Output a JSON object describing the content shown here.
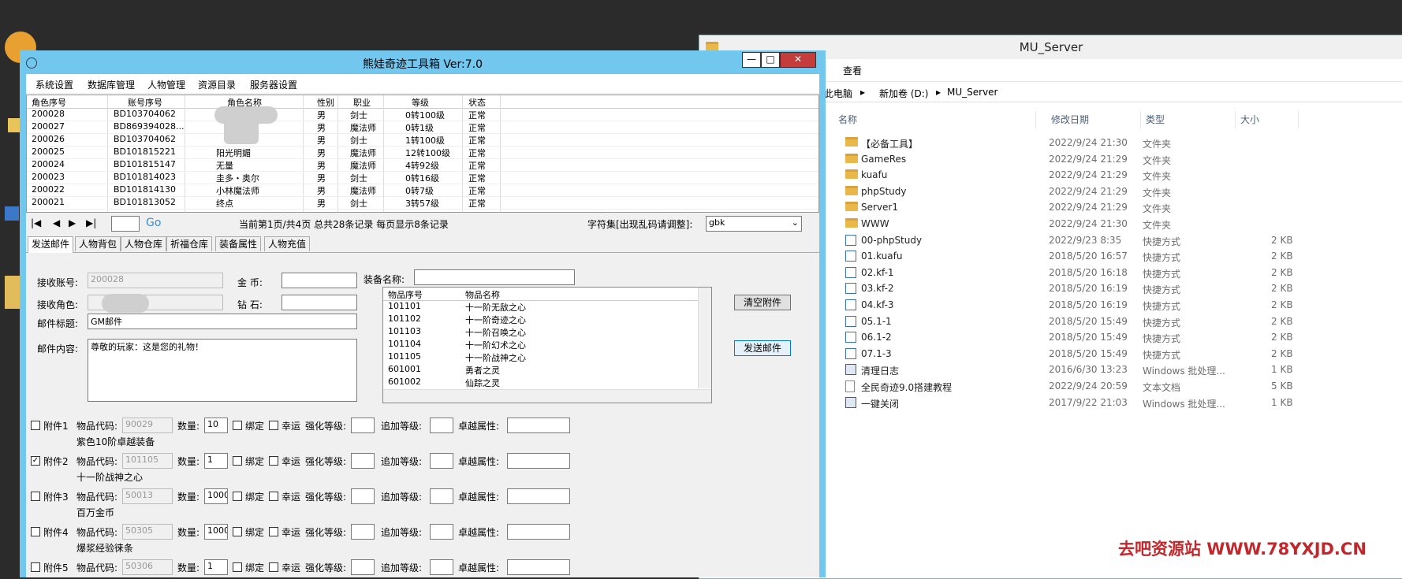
{
  "explorer": {
    "title": "MU_Server",
    "ribbon_view": "查看",
    "breadcrumb": [
      "此电脑",
      "新加卷 (D:)",
      "MU_Server"
    ],
    "columns": [
      "名称",
      "修改日期",
      "类型",
      "大小"
    ],
    "files": [
      {
        "name": "【必备工具】",
        "date": "2022/9/24 21:30",
        "type": "文件夹",
        "size": "",
        "icon": "folder-icon"
      },
      {
        "name": "GameRes",
        "date": "2022/9/24 21:29",
        "type": "文件夹",
        "size": "",
        "icon": "folder-icon"
      },
      {
        "name": "kuafu",
        "date": "2022/9/24 21:29",
        "type": "文件夹",
        "size": "",
        "icon": "folder-icon"
      },
      {
        "name": "phpStudy",
        "date": "2022/9/24 21:29",
        "type": "文件夹",
        "size": "",
        "icon": "folder-icon"
      },
      {
        "name": "Server1",
        "date": "2022/9/24 21:29",
        "type": "文件夹",
        "size": "",
        "icon": "folder-icon"
      },
      {
        "name": "WWW",
        "date": "2022/9/24 21:30",
        "type": "文件夹",
        "size": "",
        "icon": "folder-icon"
      },
      {
        "name": "00-phpStudy",
        "date": "2022/9/23 8:35",
        "type": "快捷方式",
        "size": "2 KB",
        "icon": "shortcut-icon"
      },
      {
        "name": "01.kuafu",
        "date": "2018/5/20 16:57",
        "type": "快捷方式",
        "size": "2 KB",
        "icon": "shortcut-icon"
      },
      {
        "name": "02.kf-1",
        "date": "2018/5/20 16:18",
        "type": "快捷方式",
        "size": "2 KB",
        "icon": "shortcut-icon"
      },
      {
        "name": "03.kf-2",
        "date": "2018/5/20 16:19",
        "type": "快捷方式",
        "size": "2 KB",
        "icon": "shortcut-icon"
      },
      {
        "name": "04.kf-3",
        "date": "2018/5/20 16:19",
        "type": "快捷方式",
        "size": "2 KB",
        "icon": "shortcut-icon"
      },
      {
        "name": "05.1-1",
        "date": "2018/5/20 15:49",
        "type": "快捷方式",
        "size": "2 KB",
        "icon": "shortcut-icon"
      },
      {
        "name": "06.1-2",
        "date": "2018/5/20 15:49",
        "type": "快捷方式",
        "size": "2 KB",
        "icon": "shortcut-icon"
      },
      {
        "name": "07.1-3",
        "date": "2018/5/20 15:49",
        "type": "快捷方式",
        "size": "2 KB",
        "icon": "shortcut-icon"
      },
      {
        "name": "清理日志",
        "date": "2016/6/30 13:23",
        "type": "Windows 批处理...",
        "size": "1 KB",
        "icon": "batch-file-icon"
      },
      {
        "name": "全民奇迹9.0搭建教程",
        "date": "2022/9/24 20:59",
        "type": "文本文档",
        "size": "5 KB",
        "icon": "text-file-icon"
      },
      {
        "name": "一键关闭",
        "date": "2017/9/22 21:03",
        "type": "Windows 批处理...",
        "size": "1 KB",
        "icon": "batch-file-icon"
      }
    ]
  },
  "watermark": "去吧资源站  WWW.78YXJD.CN",
  "app": {
    "title": "熊娃奇迹工具箱 Ver:7.0",
    "menu": [
      "系统设置",
      "数据库管理",
      "人物管理",
      "资源目录",
      "服务器设置"
    ],
    "grid_columns": [
      "角色序号",
      "账号序号",
      "角色名称",
      "性别",
      "职业",
      "等级",
      "状态"
    ],
    "grid_rows": [
      {
        "id": "200028",
        "acct": "BD103704062",
        "name": "",
        "sex": "男",
        "job": "剑士",
        "level": "0转100级",
        "status": "正常"
      },
      {
        "id": "200027",
        "acct": "BD869394028...",
        "name": "",
        "sex": "男",
        "job": "魔法师",
        "level": "0转1级",
        "status": "正常"
      },
      {
        "id": "200026",
        "acct": "BD103704062",
        "name": "",
        "sex": "男",
        "job": "剑士",
        "level": "1转100级",
        "status": "正常"
      },
      {
        "id": "200025",
        "acct": "BD101815221",
        "name": "阳光明媚",
        "sex": "男",
        "job": "魔法师",
        "level": "12转100级",
        "status": "正常"
      },
      {
        "id": "200024",
        "acct": "BD101815147",
        "name": "无量",
        "sex": "男",
        "job": "魔法师",
        "level": "4转92级",
        "status": "正常"
      },
      {
        "id": "200023",
        "acct": "BD101814023",
        "name": "圭多・奥尔",
        "sex": "男",
        "job": "剑士",
        "level": "0转16级",
        "status": "正常"
      },
      {
        "id": "200022",
        "acct": "BD101814130",
        "name": "小林魔法师",
        "sex": "男",
        "job": "魔法师",
        "level": "0转7级",
        "status": "正常"
      },
      {
        "id": "200021",
        "acct": "BD101813052",
        "name": "终点",
        "sex": "男",
        "job": "剑士",
        "level": "3转57级",
        "status": "正常"
      }
    ],
    "pager": {
      "go": "Go",
      "info": "当前第1页/共4页 总共28条记录 每页显示8条记录",
      "charset_label": "字符集[出现乱码请调整]:",
      "charset_value": "gbk"
    },
    "tabs": [
      "发送邮件",
      "人物背包",
      "人物仓库",
      "祈福仓库",
      "装备属性",
      "人物充值"
    ],
    "mail": {
      "recv_account_label": "接收账号:",
      "recv_account": "200028",
      "recv_role_label": "接收角色:",
      "gold_label": "金   币:",
      "diamond_label": "钻   石:",
      "equip_name_label": "装备名称:",
      "subject_label": "邮件标题:",
      "subject": "GM邮件",
      "content_label": "邮件内容:",
      "content": "尊敬的玩家：这是您的礼物！",
      "clear_button": "清空附件",
      "send_button": "发送邮件"
    },
    "item_list": {
      "columns": [
        "物品序号",
        "物品名称"
      ],
      "rows": [
        {
          "id": "101101",
          "name": "十一阶无敌之心"
        },
        {
          "id": "101102",
          "name": "十一阶奇迹之心"
        },
        {
          "id": "101103",
          "name": "十一阶召唤之心"
        },
        {
          "id": "101104",
          "name": "十一阶幻术之心"
        },
        {
          "id": "101105",
          "name": "十一阶战神之心"
        },
        {
          "id": "601001",
          "name": "勇者之灵"
        },
        {
          "id": "601002",
          "name": "仙踪之灵"
        }
      ]
    },
    "attach_labels": {
      "code": "物品代码:",
      "qty": "数量:",
      "bind": "绑定",
      "luck": "幸运",
      "enhance": "强化等级:",
      "add": "追加等级:",
      "excellent": "卓越属性:"
    },
    "attachments": [
      {
        "label": "附件1",
        "checked": false,
        "code": "90029",
        "qty": "10",
        "desc": "紫色10阶卓越装备"
      },
      {
        "label": "附件2",
        "checked": true,
        "code": "101105",
        "qty": "1",
        "desc": "十一阶战神之心"
      },
      {
        "label": "附件3",
        "checked": false,
        "code": "50013",
        "qty": "1000",
        "desc": "百万金币"
      },
      {
        "label": "附件4",
        "checked": false,
        "code": "50305",
        "qty": "1000",
        "desc": "爆浆经验徕条"
      },
      {
        "label": "附件5",
        "checked": false,
        "code": "50306",
        "qty": "1",
        "desc": ""
      }
    ]
  }
}
